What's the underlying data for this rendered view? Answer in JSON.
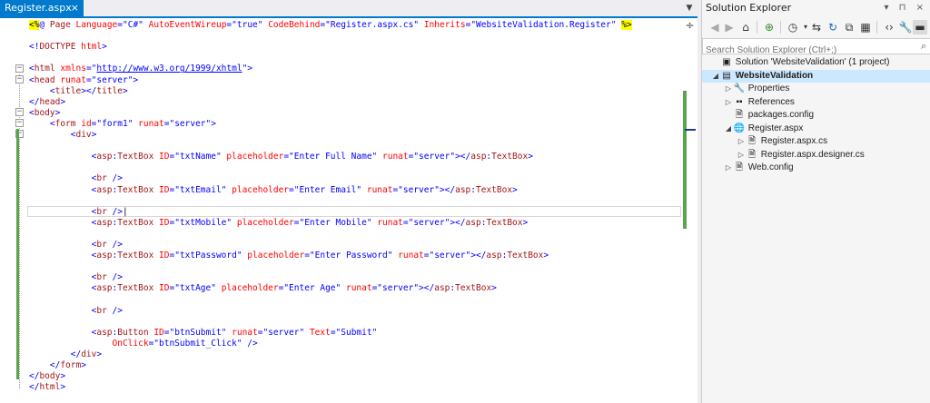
{
  "editor": {
    "tab_label": "Register.aspx",
    "tab_close": "×",
    "lines": [
      [
        {
          "t": "<%",
          "c": "dir"
        },
        {
          "t": "@ ",
          "c": "blue"
        },
        {
          "t": "Page ",
          "c": "maroon"
        },
        {
          "t": "Language",
          "c": "red"
        },
        {
          "t": "=",
          "c": "blue"
        },
        {
          "t": "\"C#\" ",
          "c": "blue"
        },
        {
          "t": "AutoEventWireup",
          "c": "red"
        },
        {
          "t": "=",
          "c": "blue"
        },
        {
          "t": "\"true\" ",
          "c": "blue"
        },
        {
          "t": "CodeBehind",
          "c": "red"
        },
        {
          "t": "=",
          "c": "blue"
        },
        {
          "t": "\"Register.aspx.cs\" ",
          "c": "blue"
        },
        {
          "t": "Inherits",
          "c": "red"
        },
        {
          "t": "=",
          "c": "blue"
        },
        {
          "t": "\"WebsiteValidation.Register\" ",
          "c": "blue"
        },
        {
          "t": "%>",
          "c": "dir"
        }
      ],
      [],
      [
        {
          "t": "<!",
          "c": "blue"
        },
        {
          "t": "DOCTYPE ",
          "c": "maroon"
        },
        {
          "t": "html",
          "c": "red"
        },
        {
          "t": ">",
          "c": "blue"
        }
      ],
      [],
      [
        {
          "t": "<",
          "c": "blue"
        },
        {
          "t": "html ",
          "c": "maroon"
        },
        {
          "t": "xmlns",
          "c": "red"
        },
        {
          "t": "=\"",
          "c": "blue"
        },
        {
          "t": "http://www.w3.org/1999/xhtml",
          "c": "link"
        },
        {
          "t": "\">",
          "c": "blue"
        }
      ],
      [
        {
          "t": "<",
          "c": "blue"
        },
        {
          "t": "head ",
          "c": "maroon"
        },
        {
          "t": "runat",
          "c": "red"
        },
        {
          "t": "=\"server\">",
          "c": "blue"
        }
      ],
      [
        {
          "t": "    <",
          "c": "blue"
        },
        {
          "t": "title",
          "c": "maroon"
        },
        {
          "t": "></",
          "c": "blue"
        },
        {
          "t": "title",
          "c": "maroon"
        },
        {
          "t": ">",
          "c": "blue"
        }
      ],
      [
        {
          "t": "</",
          "c": "blue"
        },
        {
          "t": "head",
          "c": "maroon"
        },
        {
          "t": ">",
          "c": "blue"
        }
      ],
      [
        {
          "t": "<",
          "c": "blue"
        },
        {
          "t": "body",
          "c": "maroon"
        },
        {
          "t": ">",
          "c": "blue"
        }
      ],
      [
        {
          "t": "    <",
          "c": "blue"
        },
        {
          "t": "form ",
          "c": "maroon"
        },
        {
          "t": "id",
          "c": "red"
        },
        {
          "t": "=\"form1\" ",
          "c": "blue"
        },
        {
          "t": "runat",
          "c": "red"
        },
        {
          "t": "=\"server\">",
          "c": "blue"
        }
      ],
      [
        {
          "t": "        <",
          "c": "blue"
        },
        {
          "t": "div",
          "c": "maroon"
        },
        {
          "t": ">",
          "c": "blue"
        }
      ],
      [],
      [
        {
          "t": "            <",
          "c": "blue"
        },
        {
          "t": "asp",
          "c": "maroon"
        },
        {
          "t": ":",
          "c": "blue"
        },
        {
          "t": "TextBox ",
          "c": "maroon"
        },
        {
          "t": "ID",
          "c": "red"
        },
        {
          "t": "=\"txtName\" ",
          "c": "blue"
        },
        {
          "t": "placeholder",
          "c": "red"
        },
        {
          "t": "=\"Enter Full Name\" ",
          "c": "blue"
        },
        {
          "t": "runat",
          "c": "red"
        },
        {
          "t": "=\"server\"></",
          "c": "blue"
        },
        {
          "t": "asp",
          "c": "maroon"
        },
        {
          "t": ":",
          "c": "blue"
        },
        {
          "t": "TextBox",
          "c": "maroon"
        },
        {
          "t": ">",
          "c": "blue"
        }
      ],
      [],
      [
        {
          "t": "            <",
          "c": "blue"
        },
        {
          "t": "br ",
          "c": "maroon"
        },
        {
          "t": "/>",
          "c": "blue"
        }
      ],
      [
        {
          "t": "            <",
          "c": "blue"
        },
        {
          "t": "asp",
          "c": "maroon"
        },
        {
          "t": ":",
          "c": "blue"
        },
        {
          "t": "TextBox ",
          "c": "maroon"
        },
        {
          "t": "ID",
          "c": "red"
        },
        {
          "t": "=\"txtEmail\" ",
          "c": "blue"
        },
        {
          "t": "placeholder",
          "c": "red"
        },
        {
          "t": "=\"Enter Email\" ",
          "c": "blue"
        },
        {
          "t": "runat",
          "c": "red"
        },
        {
          "t": "=\"server\"></",
          "c": "blue"
        },
        {
          "t": "asp",
          "c": "maroon"
        },
        {
          "t": ":",
          "c": "blue"
        },
        {
          "t": "TextBox",
          "c": "maroon"
        },
        {
          "t": ">",
          "c": "blue"
        }
      ],
      [],
      [
        {
          "t": "            <",
          "c": "blue"
        },
        {
          "t": "br ",
          "c": "maroon"
        },
        {
          "t": "/>",
          "c": "blue"
        },
        {
          "t": "|",
          "c": ""
        }
      ],
      [
        {
          "t": "            <",
          "c": "blue"
        },
        {
          "t": "asp",
          "c": "maroon"
        },
        {
          "t": ":",
          "c": "blue"
        },
        {
          "t": "TextBox ",
          "c": "maroon"
        },
        {
          "t": "ID",
          "c": "red"
        },
        {
          "t": "=\"txtMobile\" ",
          "c": "blue"
        },
        {
          "t": "placeholder",
          "c": "red"
        },
        {
          "t": "=\"Enter Mobile\" ",
          "c": "blue"
        },
        {
          "t": "runat",
          "c": "red"
        },
        {
          "t": "=\"server\"></",
          "c": "blue"
        },
        {
          "t": "asp",
          "c": "maroon"
        },
        {
          "t": ":",
          "c": "blue"
        },
        {
          "t": "TextBox",
          "c": "maroon"
        },
        {
          "t": ">",
          "c": "blue"
        }
      ],
      [],
      [
        {
          "t": "            <",
          "c": "blue"
        },
        {
          "t": "br ",
          "c": "maroon"
        },
        {
          "t": "/>",
          "c": "blue"
        }
      ],
      [
        {
          "t": "            <",
          "c": "blue"
        },
        {
          "t": "asp",
          "c": "maroon"
        },
        {
          "t": ":",
          "c": "blue"
        },
        {
          "t": "TextBox ",
          "c": "maroon"
        },
        {
          "t": "ID",
          "c": "red"
        },
        {
          "t": "=\"txtPassword\" ",
          "c": "blue"
        },
        {
          "t": "placeholder",
          "c": "red"
        },
        {
          "t": "=\"Enter Password\" ",
          "c": "blue"
        },
        {
          "t": "runat",
          "c": "red"
        },
        {
          "t": "=\"server\"></",
          "c": "blue"
        },
        {
          "t": "asp",
          "c": "maroon"
        },
        {
          "t": ":",
          "c": "blue"
        },
        {
          "t": "TextBox",
          "c": "maroon"
        },
        {
          "t": ">",
          "c": "blue"
        }
      ],
      [],
      [
        {
          "t": "            <",
          "c": "blue"
        },
        {
          "t": "br ",
          "c": "maroon"
        },
        {
          "t": "/>",
          "c": "blue"
        }
      ],
      [
        {
          "t": "            <",
          "c": "blue"
        },
        {
          "t": "asp",
          "c": "maroon"
        },
        {
          "t": ":",
          "c": "blue"
        },
        {
          "t": "TextBox ",
          "c": "maroon"
        },
        {
          "t": "ID",
          "c": "red"
        },
        {
          "t": "=\"txtAge\" ",
          "c": "blue"
        },
        {
          "t": "placeholder",
          "c": "red"
        },
        {
          "t": "=\"Enter Age\" ",
          "c": "blue"
        },
        {
          "t": "runat",
          "c": "red"
        },
        {
          "t": "=\"server\"></",
          "c": "blue"
        },
        {
          "t": "asp",
          "c": "maroon"
        },
        {
          "t": ":",
          "c": "blue"
        },
        {
          "t": "TextBox",
          "c": "maroon"
        },
        {
          "t": ">",
          "c": "blue"
        }
      ],
      [],
      [
        {
          "t": "            <",
          "c": "blue"
        },
        {
          "t": "br ",
          "c": "maroon"
        },
        {
          "t": "/>",
          "c": "blue"
        }
      ],
      [],
      [
        {
          "t": "            <",
          "c": "blue"
        },
        {
          "t": "asp",
          "c": "maroon"
        },
        {
          "t": ":",
          "c": "blue"
        },
        {
          "t": "Button ",
          "c": "maroon"
        },
        {
          "t": "ID",
          "c": "red"
        },
        {
          "t": "=\"btnSubmit\" ",
          "c": "blue"
        },
        {
          "t": "runat",
          "c": "red"
        },
        {
          "t": "=\"server\" ",
          "c": "blue"
        },
        {
          "t": "Text",
          "c": "red"
        },
        {
          "t": "=\"Submit\"",
          "c": "blue"
        }
      ],
      [
        {
          "t": "                ",
          "c": ""
        },
        {
          "t": "OnClick",
          "c": "red"
        },
        {
          "t": "=\"btnSubmit_Click\" ",
          "c": "blue"
        },
        {
          "t": "/>",
          "c": "blue"
        }
      ],
      [
        {
          "t": "        </",
          "c": "blue"
        },
        {
          "t": "div",
          "c": "maroon"
        },
        {
          "t": ">",
          "c": "blue"
        }
      ],
      [
        {
          "t": "    </",
          "c": "blue"
        },
        {
          "t": "form",
          "c": "maroon"
        },
        {
          "t": ">",
          "c": "blue"
        }
      ],
      [
        {
          "t": "</",
          "c": "blue"
        },
        {
          "t": "body",
          "c": "maroon"
        },
        {
          "t": ">",
          "c": "blue"
        }
      ],
      [
        {
          "t": "</",
          "c": "blue"
        },
        {
          "t": "html",
          "c": "maroon"
        },
        {
          "t": ">",
          "c": "blue"
        }
      ]
    ]
  },
  "solution_explorer": {
    "title": "Solution Explorer",
    "title_buttons": "▾ ⊓ ×",
    "search_placeholder": "Search Solution Explorer (Ctrl+;)",
    "toolbar_icons": [
      "back-icon",
      "forward-icon",
      "home-icon",
      "sync-icon",
      "history-icon",
      "refresh-icon",
      "collapse-all-icon",
      "show-all-files-icon",
      "view-code-icon",
      "properties-icon",
      "preview-icon"
    ],
    "tree": [
      {
        "label": "Solution 'WebsiteValidation' (1 project)",
        "depth": 0,
        "caret": "",
        "icon": "solution-icon",
        "glyph": "▣",
        "bold": false,
        "selected": false
      },
      {
        "label": "WebsiteValidation",
        "depth": 0,
        "caret": "◢",
        "icon": "project-icon",
        "glyph": "▤",
        "bold": true,
        "selected": true
      },
      {
        "label": "Properties",
        "depth": 1,
        "caret": "▷",
        "icon": "wrench-icon",
        "glyph": "🔧",
        "bold": false,
        "selected": false
      },
      {
        "label": "References",
        "depth": 1,
        "caret": "▷",
        "icon": "references-icon",
        "glyph": "▪▪",
        "bold": false,
        "selected": false
      },
      {
        "label": "packages.config",
        "depth": 1,
        "caret": "",
        "icon": "config-file-icon",
        "glyph": "🗎",
        "bold": false,
        "selected": false
      },
      {
        "label": "Register.aspx",
        "depth": 1,
        "caret": "◢",
        "icon": "aspx-file-icon",
        "glyph": "🌐",
        "bold": false,
        "selected": false
      },
      {
        "label": "Register.aspx.cs",
        "depth": 2,
        "caret": "▷",
        "icon": "cs-file-icon",
        "glyph": "🗎",
        "bold": false,
        "selected": false
      },
      {
        "label": "Register.aspx.designer.cs",
        "depth": 2,
        "caret": "▷",
        "icon": "cs-file-icon",
        "glyph": "🗎",
        "bold": false,
        "selected": false
      },
      {
        "label": "Web.config",
        "depth": 1,
        "caret": "▷",
        "icon": "config-file-icon",
        "glyph": "🗎",
        "bold": false,
        "selected": false
      }
    ]
  }
}
